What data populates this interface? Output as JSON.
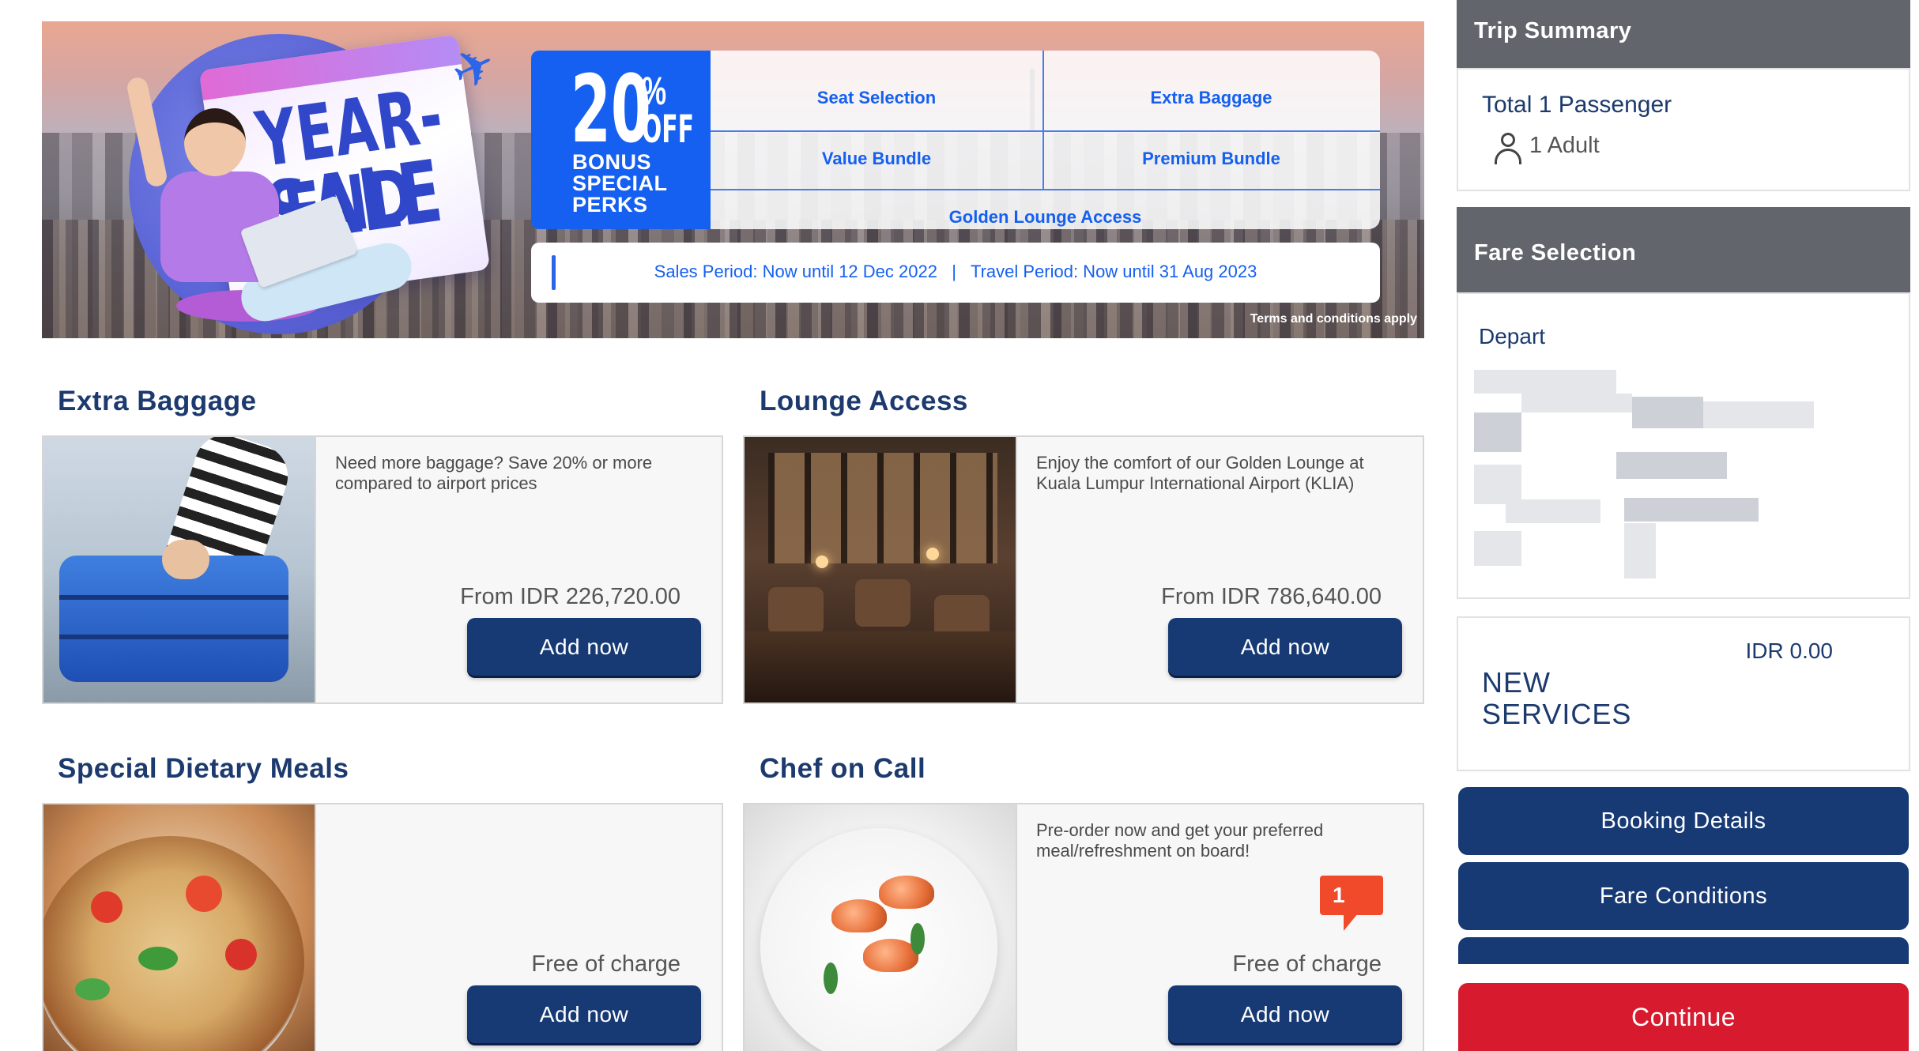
{
  "banner": {
    "headline_line1": "YEAR-END",
    "headline_line2": "SALE",
    "discount_number": "20",
    "discount_percent": "%",
    "discount_off": "OFF",
    "bonus_text": "BONUS SPECIAL PERKS",
    "perks": [
      "Seat Selection",
      "Extra Baggage",
      "Value Bundle",
      "Premium Bundle",
      "Golden Lounge Access"
    ],
    "period_text": "Sales Period: Now until 12 Dec 2022   |   Travel Period: Now until 31 Aug 2023",
    "terms": "Terms and conditions apply",
    "colors": {
      "promo_blue": "#1560f0"
    }
  },
  "services": [
    {
      "title": "Extra Baggage",
      "description": "Need more baggage? Save 20% or more compared to airport prices",
      "price": "From IDR 226,720.00",
      "button": "Add now"
    },
    {
      "title": "Lounge Access",
      "description": "Enjoy the comfort of our Golden Lounge at Kuala Lumpur International Airport (KLIA)",
      "price": "From IDR 786,640.00",
      "button": "Add now"
    },
    {
      "title": "Special Dietary Meals",
      "description": "",
      "price": "Free of charge",
      "button": "Add now"
    },
    {
      "title": "Chef on Call",
      "description": "Pre-order now and get your preferred meal/refreshment on board!",
      "price": "Free of charge",
      "button": "Add now",
      "badge": "1"
    }
  ],
  "sidebar": {
    "trip_summary_title": "Trip Summary",
    "total_passenger": "Total 1 Passenger",
    "adult": "1 Adult",
    "fare_selection_title": "Fare Selection",
    "depart_label": "Depart",
    "new_services_amount": "IDR 0.00",
    "new_services_label": "NEW SERVICES",
    "booking_details_button": "Booking Details",
    "fare_conditions_button": "Fare Conditions",
    "continue_button": "Continue",
    "colors": {
      "primary": "#173a75",
      "continue": "#d71a2e",
      "header": "#62666c"
    }
  }
}
